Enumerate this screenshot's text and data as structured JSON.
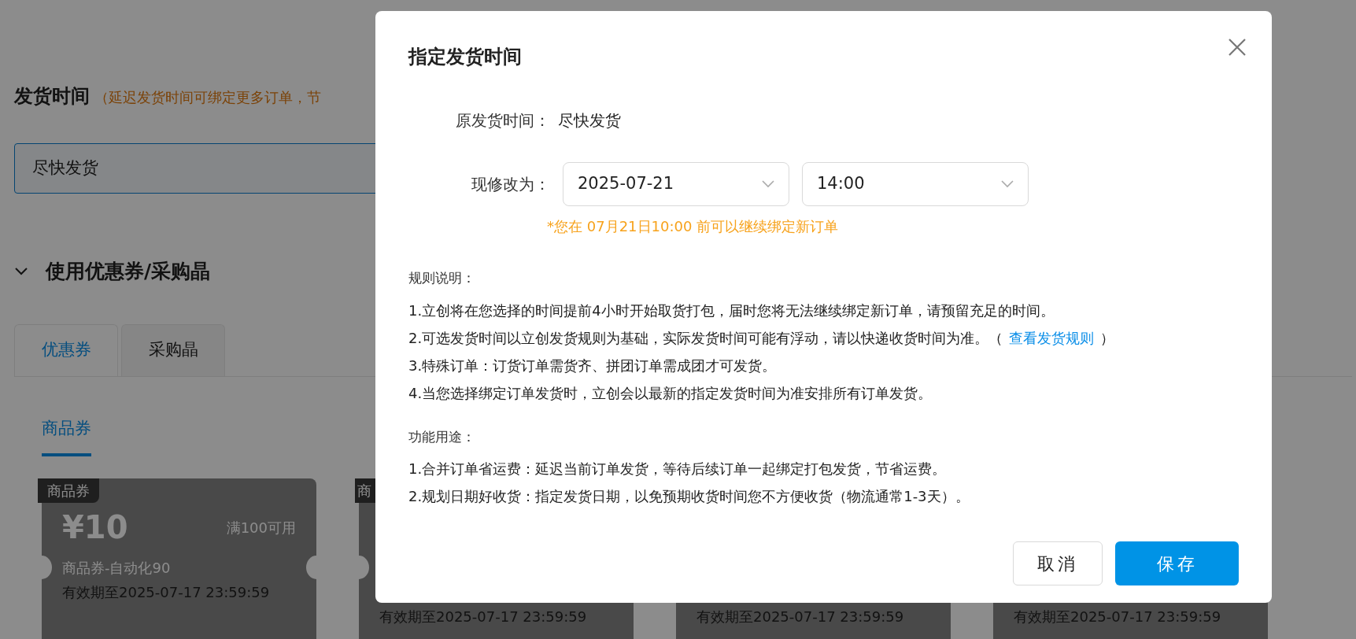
{
  "page": {
    "section_title": "发货时间",
    "section_hint": "（延迟发货时间可绑定更多订单，节",
    "ship_field": {
      "value": "尽快发货"
    },
    "coupon_section": {
      "title": "使用优惠券/采购晶",
      "expanded": true
    },
    "tabs": [
      {
        "label": "优惠券",
        "selected": true
      },
      {
        "label": "采购晶",
        "selected": false
      }
    ],
    "sub_tabs": [
      {
        "label": "商品券",
        "selected": true
      }
    ],
    "coupons": [
      {
        "tag": "商品券",
        "amount": "¥10",
        "condition": "满100可用",
        "name": "商品券-自动化90",
        "validity": "有效期至2025-07-17 23:59:59"
      },
      {
        "tag": "商",
        "validity": "有效期至2025-07-17 23:59:59"
      },
      {
        "validity": "有效期至2025-07-17 23:59:59"
      },
      {
        "validity": "有效期至2025-07-17 23:59:59"
      }
    ]
  },
  "dialog": {
    "title": "指定发货时间",
    "original_label": "原发货时间：",
    "original_value": "尽快发货",
    "new_label": "现修改为：",
    "date_select": {
      "value": "2025-07-21"
    },
    "time_select": {
      "value": "14:00"
    },
    "notice": "*您在 07月21日10:00 前可以继续绑定新订单",
    "sections": [
      {
        "heading": "规则说明：",
        "lines": [
          {
            "text": "1.立创将在您选择的时间提前4小时开始取货打包，届时您将无法继续绑定新订单，请预留充足的时间。"
          },
          {
            "text": "2.可选发货时间以立创发货规则为基础，实际发货时间可能有浮动，请以快递收货时间为准。（",
            "link": "查看发货规则",
            "after": "）"
          },
          {
            "text": "3.特殊订单：订货订单需货齐、拼团订单需成团才可发货。"
          },
          {
            "text": "4.当您选择绑定订单发货时，立创会以最新的指定发货时间为准安排所有订单发货。"
          }
        ]
      },
      {
        "heading": "功能用途：",
        "lines": [
          {
            "text": "1.合并订单省运费：延迟当前订单发货，等待后续订单一起绑定打包发货，节省运费。"
          },
          {
            "text": "2.规划日期好收货：指定发货日期，以免预期收货时间您不方便收货（物流通常1-3天）。"
          }
        ]
      }
    ],
    "buttons": [
      {
        "label": "取消",
        "kind": "secondary"
      },
      {
        "label": "保存",
        "kind": "primary"
      }
    ]
  }
}
